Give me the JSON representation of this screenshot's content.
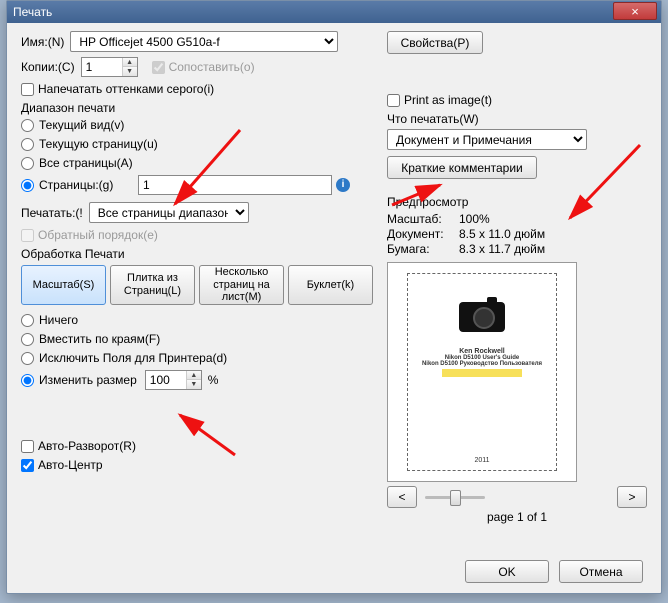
{
  "window": {
    "title": "Печать"
  },
  "name": {
    "label": "Имя:(N)",
    "value": "HP Officejet 4500 G510a-f"
  },
  "properties_btn": "Свойства(P)",
  "copies": {
    "label": "Копии:(C)",
    "value": "1"
  },
  "collate": {
    "label": "Сопоставить(o)",
    "checked": true,
    "enabled": false
  },
  "grayscale": {
    "label": "Напечатать оттенками серого(i)",
    "checked": false
  },
  "range": {
    "title": "Диапазон печати",
    "current_view": "Текущий вид(v)",
    "current_page": "Текущую страницу(u)",
    "all_pages": "Все страницы(A)",
    "pages": "Страницы:(g)",
    "pages_value": "1",
    "selected": "pages"
  },
  "print_what_row": {
    "label": "Печатать:(!",
    "value": "Все страницы диапазона"
  },
  "reverse": {
    "label": "Обратный порядок(e)",
    "checked": false,
    "enabled": false
  },
  "handling": {
    "title": "Обработка Печати",
    "scale": "Масштаб(S)",
    "tile": "Плитка из Страниц(L)",
    "multi": "Несколько страниц на лист(M)",
    "booklet": "Буклет(k)"
  },
  "scale_opts": {
    "none": "Ничего",
    "fit": "Вместить по краям(F)",
    "exclude": "Исключить Поля для Принтера(d)",
    "resize": "Изменить размер",
    "resize_value": "100",
    "unit": "%",
    "selected": "resize"
  },
  "auto_rotate": {
    "label": "Авто-Разворот(R)",
    "checked": false
  },
  "auto_center": {
    "label": "Авто-Центр",
    "checked": true
  },
  "print_as_image": {
    "label": "Print as image(t)",
    "checked": false
  },
  "what_print": {
    "label": "Что печатать(W)",
    "value": "Документ и Примечания"
  },
  "comments_btn": "Краткие комментарии",
  "preview": {
    "title": "Предпросмотр",
    "scale_k": "Масштаб:",
    "scale_v": "100%",
    "doc_k": "Документ:",
    "doc_v": "8.5 x 11.0 дюйм",
    "paper_k": "Бумага:",
    "paper_v": "8.3 x 11.7 дюйм",
    "page_label": "page 1 of 1",
    "doc_title1": "Ken Rockwell",
    "doc_title2": "Nikon D5100 User's Guide",
    "doc_title3": "Nikon D5100 Руководство Пользователя",
    "doc_year": "2011"
  },
  "nav": {
    "prev": "<",
    "next": ">"
  },
  "buttons": {
    "ok": "OK",
    "cancel": "Отмена"
  }
}
